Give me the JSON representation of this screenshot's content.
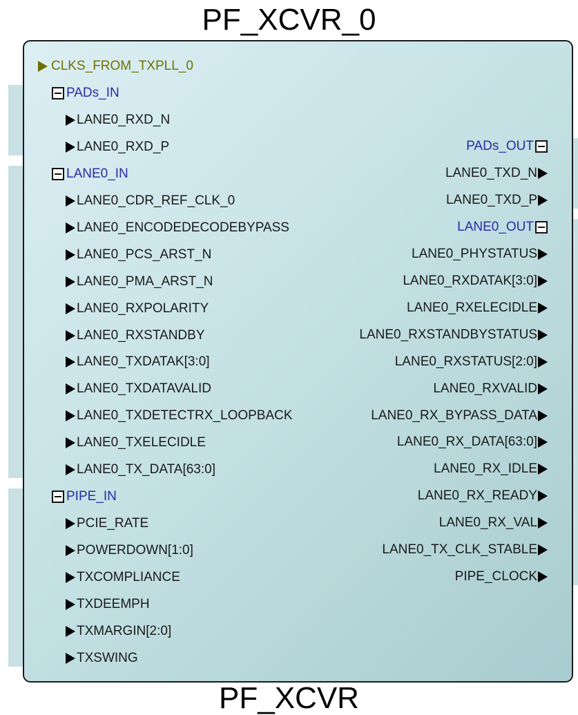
{
  "title": "PF_XCVR_0",
  "subtitle": "PF_XCVR",
  "clock_port": "CLKS_FROM_TXPLL_0",
  "left_groups": [
    {
      "name": "PADs_IN",
      "pins": [
        "LANE0_RXD_N",
        "LANE0_RXD_P"
      ]
    },
    {
      "name": "LANE0_IN",
      "pins": [
        "LANE0_CDR_REF_CLK_0",
        "LANE0_ENCODEDECODEBYPASS",
        "LANE0_PCS_ARST_N",
        "LANE0_PMA_ARST_N",
        "LANE0_RXPOLARITY",
        "LANE0_RXSTANDBY",
        "LANE0_TXDATAK[3:0]",
        "LANE0_TXDATAVALID",
        "LANE0_TXDETECTRX_LOOPBACK",
        "LANE0_TXELECIDLE",
        "LANE0_TX_DATA[63:0]"
      ]
    },
    {
      "name": "PIPE_IN",
      "pins": [
        "PCIE_RATE",
        "POWERDOWN[1:0]",
        "TXCOMPLIANCE",
        "TXDEEMPH",
        "TXMARGIN[2:0]",
        "TXSWING"
      ]
    }
  ],
  "right_groups": [
    {
      "name": "PADs_OUT",
      "pins": [
        "LANE0_TXD_N",
        "LANE0_TXD_P"
      ]
    },
    {
      "name": "LANE0_OUT",
      "pins": [
        "LANE0_PHYSTATUS",
        "LANE0_RXDATAK[3:0]",
        "LANE0_RXELECIDLE",
        "LANE0_RXSTANDBYSTATUS",
        "LANE0_RXSTATUS[2:0]",
        "LANE0_RXVALID",
        "LANE0_RX_BYPASS_DATA",
        "LANE0_RX_DATA[63:0]",
        "LANE0_RX_IDLE",
        "LANE0_RX_READY",
        "LANE0_RX_VAL",
        "LANE0_TX_CLK_STABLE",
        "PIPE_CLOCK"
      ]
    }
  ]
}
